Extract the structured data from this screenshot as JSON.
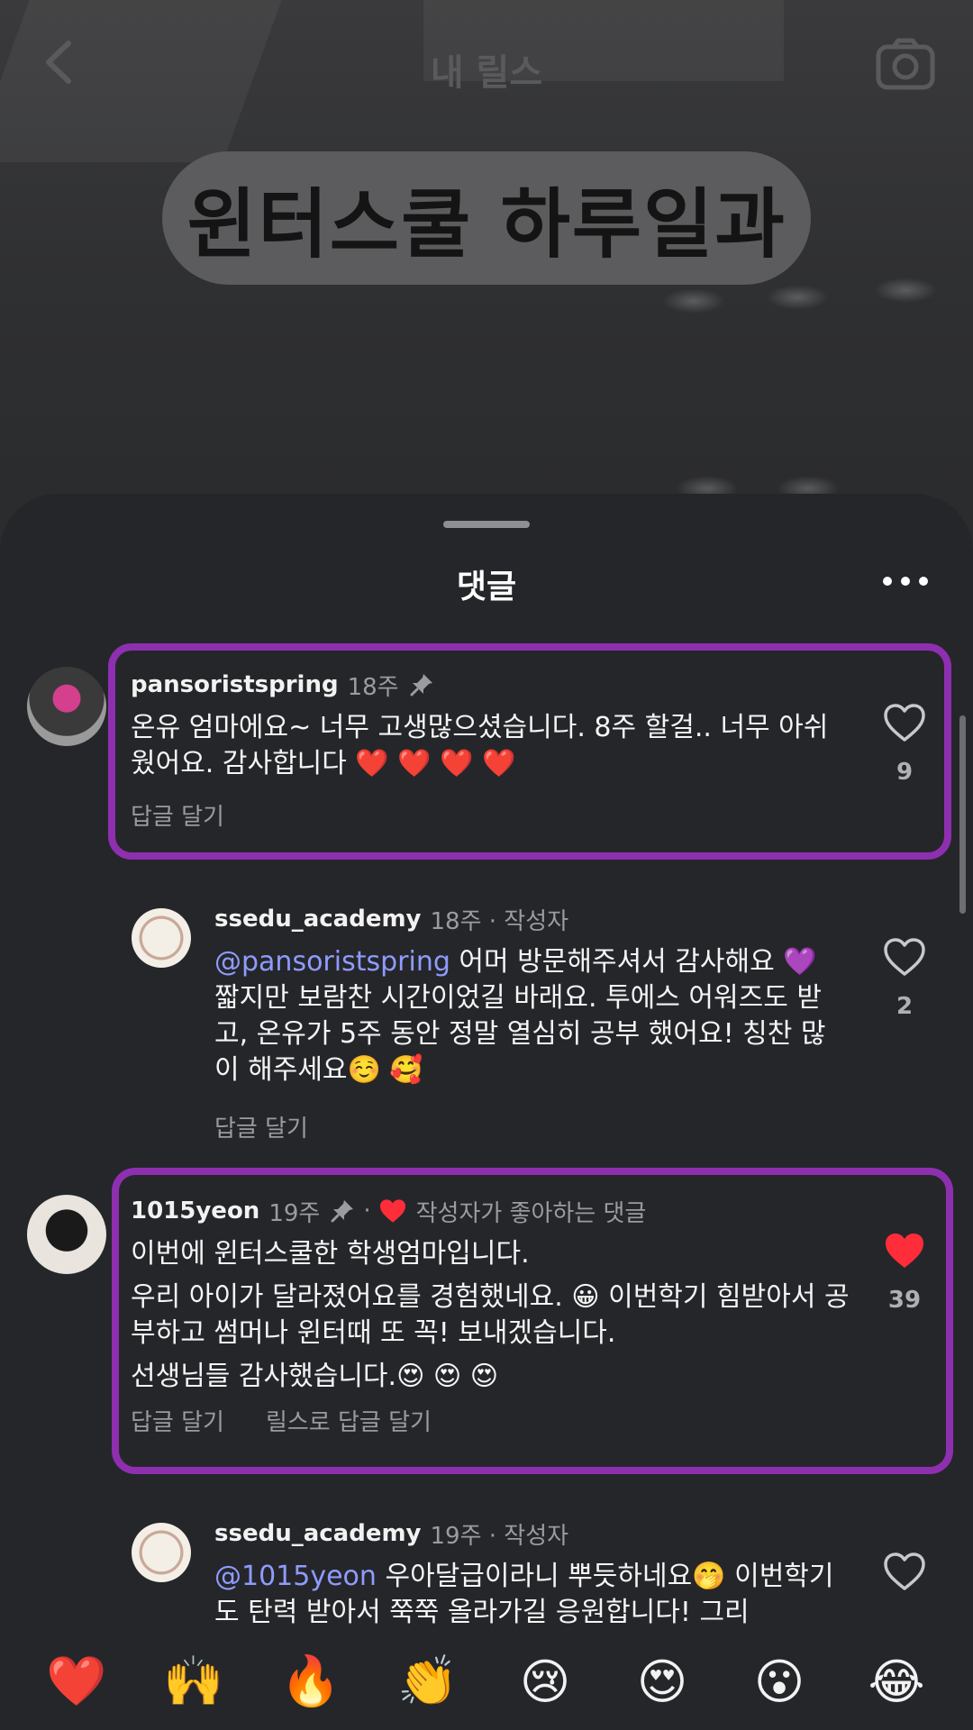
{
  "header": {
    "title": "내 릴스",
    "caption": "윈터스쿨 하루일과"
  },
  "sheet": {
    "title": "댓글"
  },
  "comments": [
    {
      "username": "pansoristspring",
      "meta": "18주",
      "text_lines": [
        "온유 엄마에요~ 너무 고생많으셨습니다. 8주 할걸.. 너무 아쉬웠어요. 감사합니다 ❤️ ❤️ ❤️ ❤️"
      ],
      "reply_label": "답글 달기",
      "like_count": "9",
      "liked": false
    },
    {
      "username": "ssedu_academy",
      "meta": "18주 · 작성자",
      "mention": "@pansoristspring",
      "text": " 어머 방문해주셔서 감사해요 💜 짧지만 보람찬 시간이었길 바래요. 투에스 어워즈도 받고, 온유가 5주 동안 정말 열심히 공부 했어요! 칭찬 많이 해주세요☺️ 🥰",
      "reply_label": "답글 달기",
      "like_count": "2",
      "liked": false
    },
    {
      "username": "1015yeon",
      "meta": "19주",
      "author_liked_label": "작성자가 좋아하는 댓글",
      "text_lines": [
        "이번에 윈터스쿨한 학생엄마입니다.",
        "우리 아이가 달라졌어요를 경험했네요. 😀  이번학기 힘받아서 공부하고 썸머나 윈터때 또 꼭! 보내겠습니다.",
        "선생님들 감사했습니다.😍 😍 😍"
      ],
      "reply_label": "답글 달기",
      "reel_reply_label": "릴스로 답글 달기",
      "like_count": "39",
      "liked": true
    },
    {
      "username": "ssedu_academy",
      "meta": "19주 · 작성자",
      "mention": "@1015yeon",
      "text": " 우아달급이라니 뿌듯하네요🤭 이번학기도 탄력 받아서 쭉쭉 올라가길 응원합니다! 그리",
      "liked": false
    }
  ],
  "reactions": [
    "❤️",
    "🙌",
    "🔥",
    "👏",
    "😢",
    "😍",
    "😮",
    "😂"
  ],
  "colors": {
    "highlight": "#8e2fb0",
    "mention": "#8f9bff",
    "like_red": "#ff2d3a"
  }
}
